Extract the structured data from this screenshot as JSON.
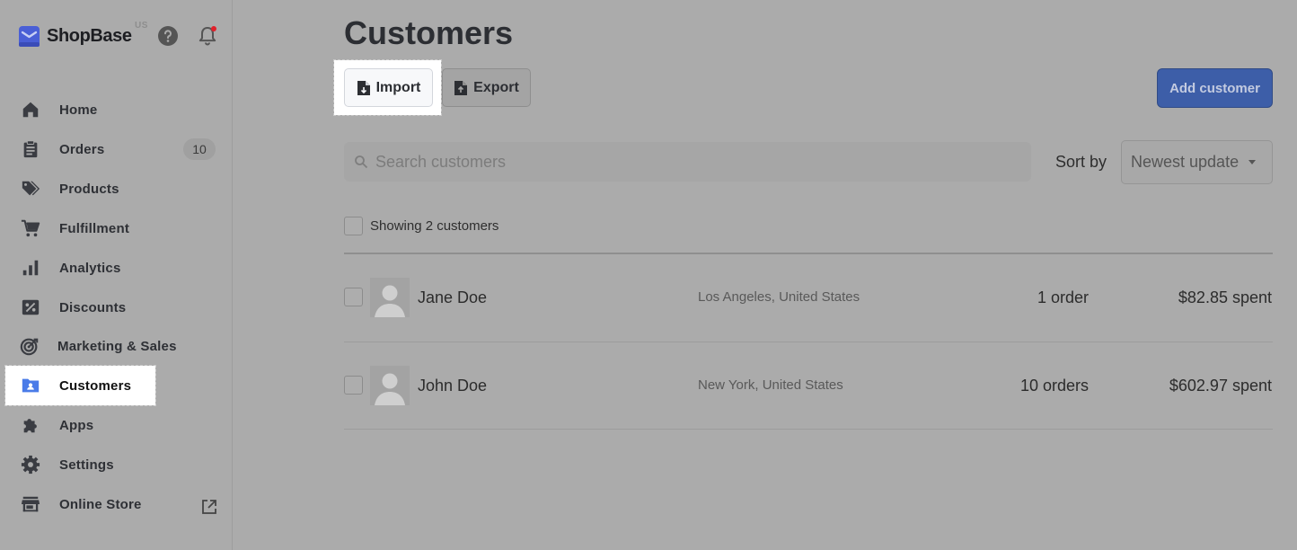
{
  "brand": {
    "name": "ShopBase",
    "region": "US"
  },
  "nav": [
    {
      "label": "Home",
      "icon": "home-icon"
    },
    {
      "label": "Orders",
      "icon": "clipboard-icon",
      "badge": "10"
    },
    {
      "label": "Products",
      "icon": "tag-icon"
    },
    {
      "label": "Fulfillment",
      "icon": "cart-icon"
    },
    {
      "label": "Analytics",
      "icon": "bar-chart-icon"
    },
    {
      "label": "Discounts",
      "icon": "percent-icon"
    },
    {
      "label": "Marketing & Sales",
      "icon": "target-icon"
    },
    {
      "label": "Customers",
      "icon": "customer-folder-icon",
      "active": true
    },
    {
      "label": "Apps",
      "icon": "puzzle-icon"
    },
    {
      "label": "Settings",
      "icon": "gear-icon"
    },
    {
      "label": "Online Store",
      "icon": "store-icon"
    }
  ],
  "page": {
    "title": "Customers"
  },
  "toolbar": {
    "import_label": "Import",
    "export_label": "Export",
    "add_label": "Add customer"
  },
  "search": {
    "placeholder": "Search customers",
    "value": ""
  },
  "sort": {
    "label": "Sort by",
    "selected": "Newest update"
  },
  "list": {
    "showing": "Showing 2 customers",
    "customers": [
      {
        "name": "Jane Doe",
        "location": "Los Angeles, United States",
        "orders": "1 order",
        "spent": "$82.85 spent"
      },
      {
        "name": "John Doe",
        "location": "New York, United States",
        "orders": "10 orders",
        "spent": "$602.97 spent"
      }
    ]
  },
  "colors": {
    "accent": "#3d5ea8",
    "notification": "#e0202a",
    "brand_logo": "#4a5fd6"
  }
}
